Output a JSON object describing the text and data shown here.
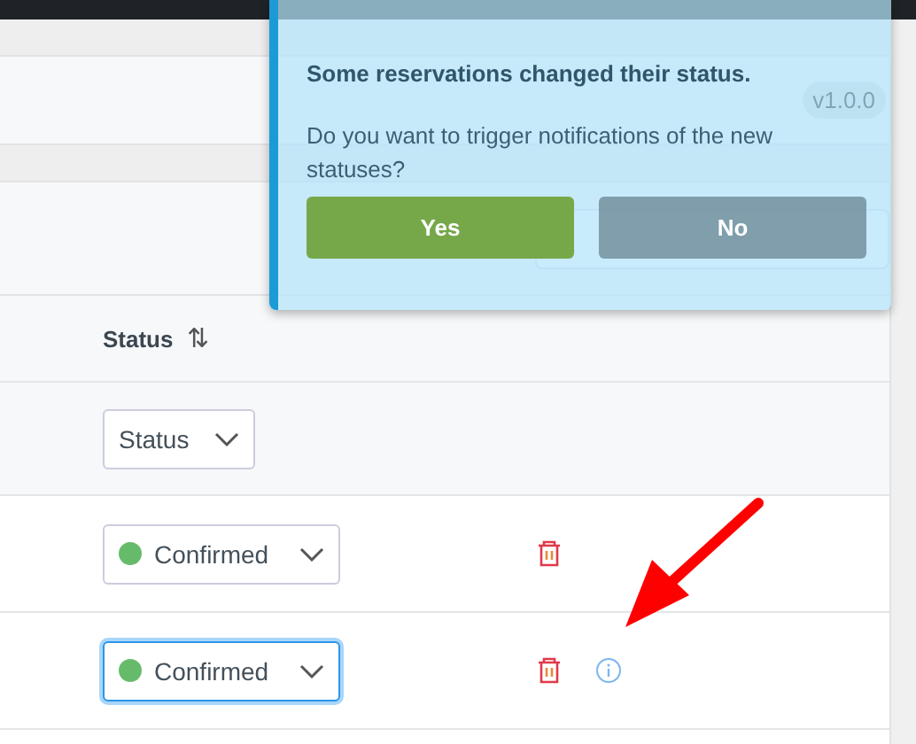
{
  "header": {
    "version": "v1.0.0"
  },
  "table": {
    "status_column": {
      "label": "Status",
      "sort_icon": "⇅"
    },
    "filter": {
      "value": "Status"
    },
    "rows": [
      {
        "status": "Confirmed",
        "color": "#66bb6a",
        "focused": false,
        "has_info": false
      },
      {
        "status": "Confirmed",
        "color": "#66bb6a",
        "focused": true,
        "has_info": true
      }
    ]
  },
  "toast": {
    "title": "Some reservations changed their status.",
    "message": "Do you want to trigger notifications of the new statuses?",
    "buttons": [
      {
        "label": "Yes",
        "kind": "confirm"
      },
      {
        "label": "No",
        "kind": "cancel"
      }
    ]
  },
  "annotation": {
    "kind": "arrow"
  }
}
